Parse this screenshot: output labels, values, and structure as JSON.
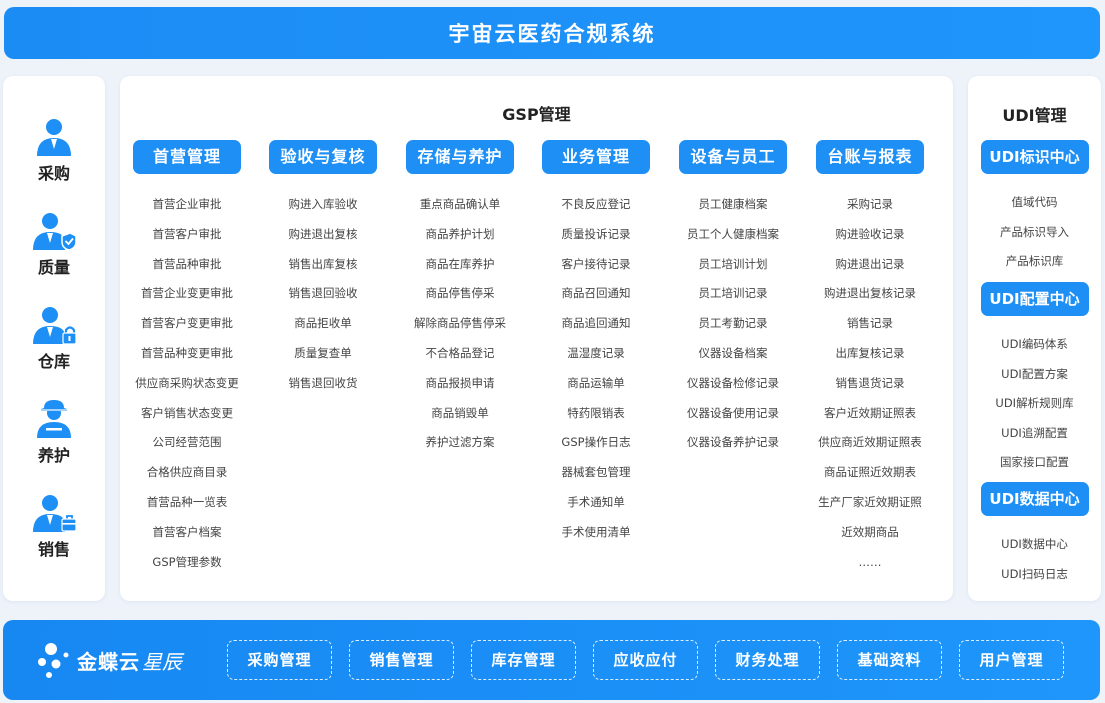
{
  "title": "宇宙云医药合规系统",
  "roles": [
    {
      "label": "采购",
      "icon": "buyer-person-icon"
    },
    {
      "label": "质量",
      "icon": "quality-person-shield-icon"
    },
    {
      "label": "仓库",
      "icon": "warehouse-person-lock-icon"
    },
    {
      "label": "养护",
      "icon": "maintenance-worker-icon"
    },
    {
      "label": "销售",
      "icon": "sales-person-briefcase-icon"
    }
  ],
  "gsp": {
    "title": "GSP管理",
    "columns": [
      {
        "title": "首营管理",
        "items": [
          "首营企业审批",
          "首营客户审批",
          "首营品种审批",
          "首营企业变更审批",
          "首营客户变更审批",
          "首营品种变更审批",
          "供应商采购状态变更",
          "客户销售状态变更",
          "公司经营范围",
          "合格供应商目录",
          "首营品种一览表",
          "首营客户档案",
          "GSP管理参数"
        ]
      },
      {
        "title": "验收与复核",
        "items": [
          "购进入库验收",
          "购进退出复核",
          "销售出库复核",
          "销售退回验收",
          "商品拒收单",
          "质量复查单",
          "销售退回收货"
        ]
      },
      {
        "title": "存储与养护",
        "items": [
          "重点商品确认单",
          "商品养护计划",
          "商品在库养护",
          "商品停售停采",
          "解除商品停售停采",
          "不合格品登记",
          "商品报损申请",
          "商品销毁单",
          "养护过滤方案"
        ]
      },
      {
        "title": "业务管理",
        "items": [
          "不良反应登记",
          "质量投诉记录",
          "客户接待记录",
          "商品召回通知",
          "商品追回通知",
          "温湿度记录",
          "商品运输单",
          "特药限销表",
          "GSP操作日志",
          "器械套包管理",
          "手术通知单",
          "手术使用清单"
        ]
      },
      {
        "title": "设备与员工",
        "items": [
          "员工健康档案",
          "员工个人健康档案",
          "员工培训计划",
          "员工培训记录",
          "员工考勤记录",
          "仪器设备档案",
          "仪器设备检修记录",
          "仪器设备使用记录",
          "仪器设备养护记录"
        ]
      },
      {
        "title": "台账与报表",
        "items": [
          "采购记录",
          "购进验收记录",
          "购进退出记录",
          "购进退出复核记录",
          "销售记录",
          "出库复核记录",
          "销售退货记录",
          "客户近效期证照表",
          "供应商近效期证照表",
          "商品证照近效期表",
          "生产厂家近效期证照",
          "近效期商品",
          "……"
        ]
      }
    ]
  },
  "udi": {
    "title": "UDI管理",
    "groups": [
      {
        "title": "UDI标识中心",
        "items": [
          "值域代码",
          "产品标识导入",
          "产品标识库"
        ]
      },
      {
        "title": "UDI配置中心",
        "items": [
          "UDI编码体系",
          "UDI配置方案",
          "UDI解析规则库",
          "UDI追溯配置",
          "国家接口配置"
        ]
      },
      {
        "title": "UDI数据中心",
        "items": [
          "UDI数据中心",
          "UDI扫码日志"
        ]
      }
    ]
  },
  "bottom": {
    "brand_name": "金蝶云",
    "brand_sub": "星辰",
    "modules": [
      "采购管理",
      "销售管理",
      "库存管理",
      "应收应付",
      "财务处理",
      "基础资料",
      "用户管理"
    ]
  },
  "colors": {
    "accent": "#1e8ff5",
    "background": "#eef3fa"
  }
}
